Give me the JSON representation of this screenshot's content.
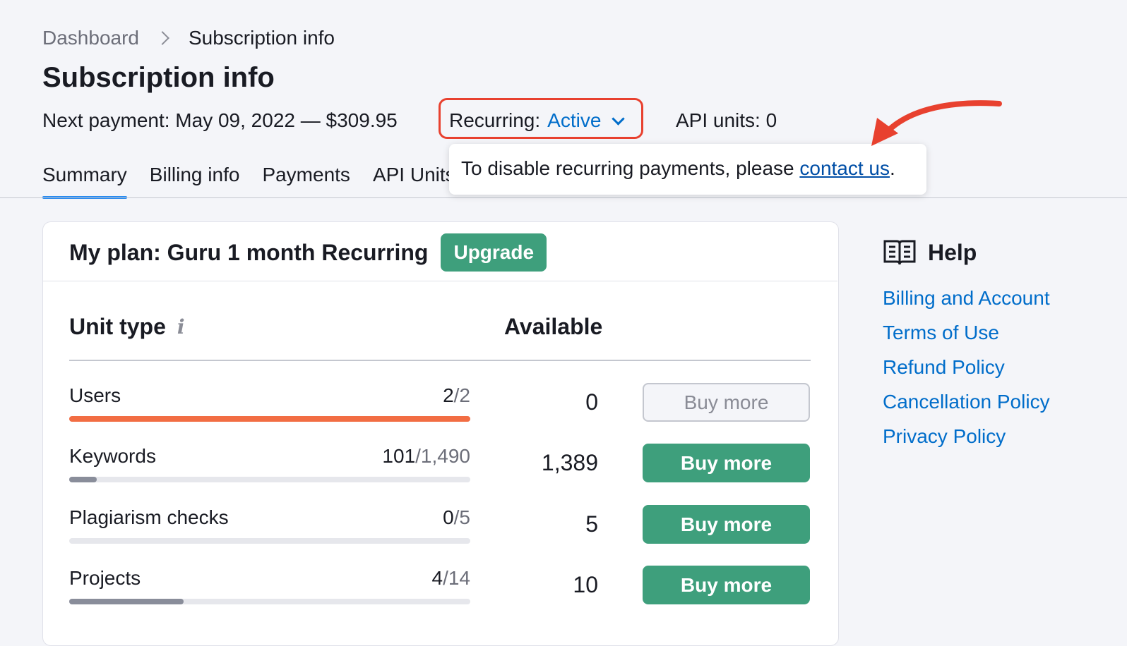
{
  "breadcrumb": {
    "root": "Dashboard",
    "current": "Subscription info"
  },
  "page": {
    "title": "Subscription info"
  },
  "payment": {
    "next_payment": "Next payment: May 09, 2022 — $309.95",
    "recurring_label": "Recurring:",
    "recurring_value": "Active",
    "api_units": "API units: 0"
  },
  "tabs": [
    {
      "label": "Summary",
      "active": true
    },
    {
      "label": "Billing info"
    },
    {
      "label": "Payments"
    },
    {
      "label": "API Units"
    }
  ],
  "tooltip": {
    "text": "To disable recurring payments, please ",
    "link": "contact us",
    "suffix": "."
  },
  "plan": {
    "title": "My plan: Guru 1 month Recurring",
    "upgrade_label": "Upgrade"
  },
  "table": {
    "col_unit": "Unit type",
    "col_available": "Available",
    "info_icon": "info-icon",
    "rows": [
      {
        "label": "Users",
        "used": "2",
        "total": "/2",
        "usage_fraction": 1.0,
        "available": "0",
        "button": "Buy more",
        "button_state": "disabled",
        "bar_color": "#f26d43"
      },
      {
        "label": "Keywords",
        "used": "101",
        "total": "/1,490",
        "usage_fraction": 0.068,
        "available": "1,389",
        "button": "Buy more",
        "button_state": "active",
        "bar_color": "#898d9a"
      },
      {
        "label": "Plagiarism checks",
        "used": "0",
        "total": "/5",
        "usage_fraction": 0.0,
        "available": "5",
        "button": "Buy more",
        "button_state": "active",
        "bar_color": "#898d9a"
      },
      {
        "label": "Projects",
        "used": "4",
        "total": "/14",
        "usage_fraction": 0.286,
        "available": "10",
        "button": "Buy more",
        "button_state": "active",
        "bar_color": "#898d9a"
      }
    ]
  },
  "help": {
    "title": "Help",
    "icon": "book-icon",
    "links": [
      "Billing and Account",
      "Terms of Use",
      "Refund Policy",
      "Cancellation Policy",
      "Privacy Policy"
    ]
  },
  "colors": {
    "accent_green": "#3e9f7c",
    "link_blue": "#006dca",
    "highlight_red": "#e8412f"
  }
}
